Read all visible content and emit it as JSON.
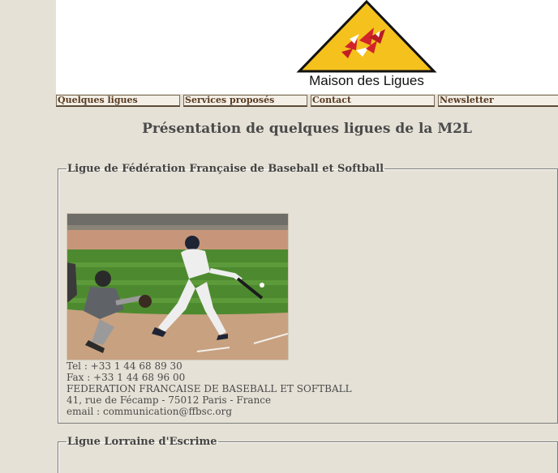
{
  "header": {
    "logo_text": "Maison des Ligues"
  },
  "nav": [
    {
      "label": "Quelques ligues"
    },
    {
      "label": "Services proposés"
    },
    {
      "label": "Contact"
    },
    {
      "label": "Newsletter"
    }
  ],
  "main": {
    "title": "Présentation de quelques ligues de la M2L"
  },
  "ligues": [
    {
      "name": "Ligue de Fédération Française de Baseball et Softball",
      "tel": "Tel : +33 1 44 68 89 30",
      "fax": "Fax : +33 1 44 68 96 00",
      "org": "FEDERATION FRANCAISE DE BASEBALL ET SOFTBALL",
      "address": "41, rue de Fécamp - 75012 Paris - France",
      "email": "email : communication@ffbsc.org"
    },
    {
      "name": "Ligue Lorraine d'Escrime"
    }
  ],
  "colors": {
    "background": "#e5e1d6",
    "logo_yellow": "#f5c11c",
    "nav_text": "#5a3b22",
    "header_bg": "#ffffff"
  }
}
